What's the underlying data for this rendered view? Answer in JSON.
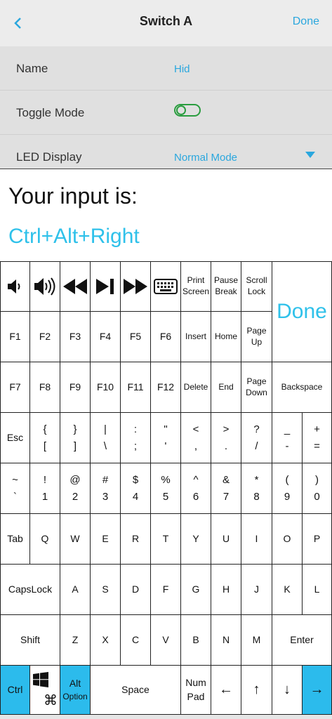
{
  "header": {
    "back_icon": "chevron-left-icon",
    "title": "Switch A",
    "done": "Done"
  },
  "settings": {
    "name_label": "Name",
    "name_value": "Hid",
    "toggle_label": "Toggle Mode",
    "toggle_on": false,
    "led_label": "LED Display",
    "led_value": "Normal Mode"
  },
  "input": {
    "prompt": "Your input is:",
    "value": "Ctrl+Alt+Right"
  },
  "keyboard": {
    "done": "Done",
    "print": "Print",
    "screen": "Screen",
    "pause": "Pause",
    "break": "Break",
    "scroll": "Scroll",
    "lock": "Lock",
    "f1": "F1",
    "f2": "F2",
    "f3": "F3",
    "f4": "F4",
    "f5": "F5",
    "f6": "F6",
    "insert": "Insert",
    "home": "Home",
    "page": "Page",
    "up": "Up",
    "f7": "F7",
    "f8": "F8",
    "f9": "F9",
    "f10": "F10",
    "f11": "F11",
    "f12": "F12",
    "delete": "Delete",
    "end": "End",
    "down": "Down",
    "backspace": "Backspace",
    "esc": "Esc",
    "brace_l_top": "{",
    "brace_l_bot": "[",
    "brace_r_top": "}",
    "brace_r_bot": "]",
    "pipe_top": "|",
    "pipe_bot": "\\",
    "colon_top": ":",
    "colon_bot": ";",
    "quote_top": "\"",
    "quote_bot": "'",
    "lt_top": "<",
    "lt_bot": ",",
    "gt_top": ">",
    "gt_bot": ".",
    "q_top": "?",
    "q_bot": "/",
    "us_top": "_",
    "us_bot": "-",
    "plus_top": "+",
    "plus_bot": "=",
    "tilde_top": "~",
    "tilde_bot": "`",
    "n1_top": "!",
    "n1_bot": "1",
    "n2_top": "@",
    "n2_bot": "2",
    "n3_top": "#",
    "n3_bot": "3",
    "n4_top": "$",
    "n4_bot": "4",
    "n5_top": "%",
    "n5_bot": "5",
    "n6_top": "^",
    "n6_bot": "6",
    "n7_top": "&",
    "n7_bot": "7",
    "n8_top": "*",
    "n8_bot": "8",
    "n9_top": "(",
    "n9_bot": "9",
    "n0_top": ")",
    "n0_bot": "0",
    "tab": "Tab",
    "q": "Q",
    "w": "W",
    "e": "E",
    "r": "R",
    "t": "T",
    "y": "Y",
    "u": "U",
    "i": "I",
    "o": "O",
    "p": "P",
    "capslock": "CapsLock",
    "a": "A",
    "s": "S",
    "d": "D",
    "f": "F",
    "g": "G",
    "h": "H",
    "j": "J",
    "k": "K",
    "l": "L",
    "shift": "Shift",
    "z": "Z",
    "x": "X",
    "c": "C",
    "v": "V",
    "b": "B",
    "n": "N",
    "m": "M",
    "enter": "Enter",
    "ctrl": "Ctrl",
    "cmd": "⌘",
    "alt": "Alt",
    "option": "Option",
    "space": "Space",
    "num": "Num",
    "pad": "Pad",
    "left": "←",
    "upar": "↑",
    "downar": "↓",
    "right": "→"
  },
  "colors": {
    "accent": "#2aa7de",
    "active_key": "#2cbbec",
    "toggle_outline": "#2a9d3f"
  },
  "icons": [
    "volume-down-icon",
    "volume-up-icon",
    "rewind-icon",
    "play-pause-icon",
    "fast-forward-icon",
    "keyboard-icon",
    "windows-icon",
    "command-icon",
    "dropdown-caret-icon"
  ]
}
